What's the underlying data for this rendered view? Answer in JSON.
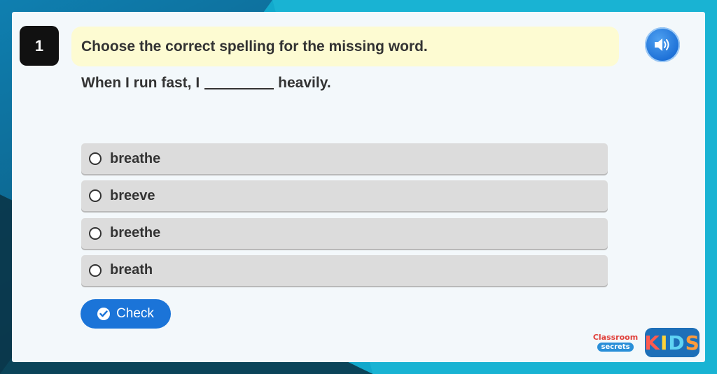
{
  "question": {
    "number": "1",
    "prompt": "Choose the correct spelling for the missing word.",
    "sentence_before": "When I run fast, I",
    "sentence_after": "heavily."
  },
  "options": [
    {
      "label": "breathe"
    },
    {
      "label": "breeve"
    },
    {
      "label": "breethe"
    },
    {
      "label": "breath"
    }
  ],
  "actions": {
    "check_label": "Check"
  },
  "branding": {
    "classroom_line1": "Classroom",
    "classroom_line2": "secrets",
    "kids_k": "K",
    "kids_i": "I",
    "kids_d": "D",
    "kids_s": "S"
  },
  "icons": {
    "audio": "speaker-icon",
    "check": "check-circle-icon"
  },
  "colors": {
    "accent_blue": "#1b74d8",
    "prompt_bg": "#fdfbd2",
    "option_bg": "#dcdcdc"
  }
}
